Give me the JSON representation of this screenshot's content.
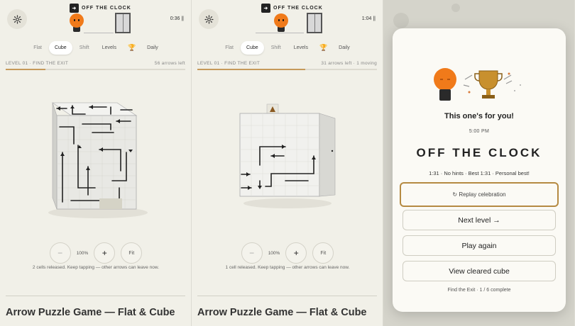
{
  "brand": "OFF THE CLOCK",
  "tabs": {
    "flat": "Flat",
    "cube": "Cube",
    "shift": "Shift",
    "levels": "Levels",
    "daily": "Daily"
  },
  "trophy_glyph": "🏆",
  "page_title": "Arrow Puzzle Game — Flat & Cube",
  "zoom": {
    "minus": "−",
    "percent": "100%",
    "plus": "+",
    "fit": "Fit"
  },
  "panel1": {
    "timer": "0:36 ||",
    "level_label": "LEVEL 01 · FIND THE EXIT",
    "arrows_status": "56 arrows left",
    "progress": 0.22,
    "hint": "2 cells released. Keep tapping — other arrows can leave now."
  },
  "panel2": {
    "timer": "1:04 ||",
    "level_label": "LEVEL 01 · FIND THE EXIT",
    "arrows_status": "31 arrows left · 1 moving",
    "progress": 0.6,
    "hint": "1 cell released. Keep tapping — other arrows can leave now."
  },
  "modal": {
    "heading": "This one's for you!",
    "time": "5:00 PM",
    "brand": "OFF THE CLOCK",
    "stats": "1:31 · No hints · Best 1:31 · Personal best!",
    "buttons": [
      "↻ Replay celebration",
      "Next level →",
      "Play again",
      "View cleared cube"
    ],
    "footer": "Find the Exit · 1 / 6 complete"
  },
  "colors": {
    "accent": "#c69a5a",
    "orange": "#f07a1a",
    "gold": "#b58a42"
  }
}
